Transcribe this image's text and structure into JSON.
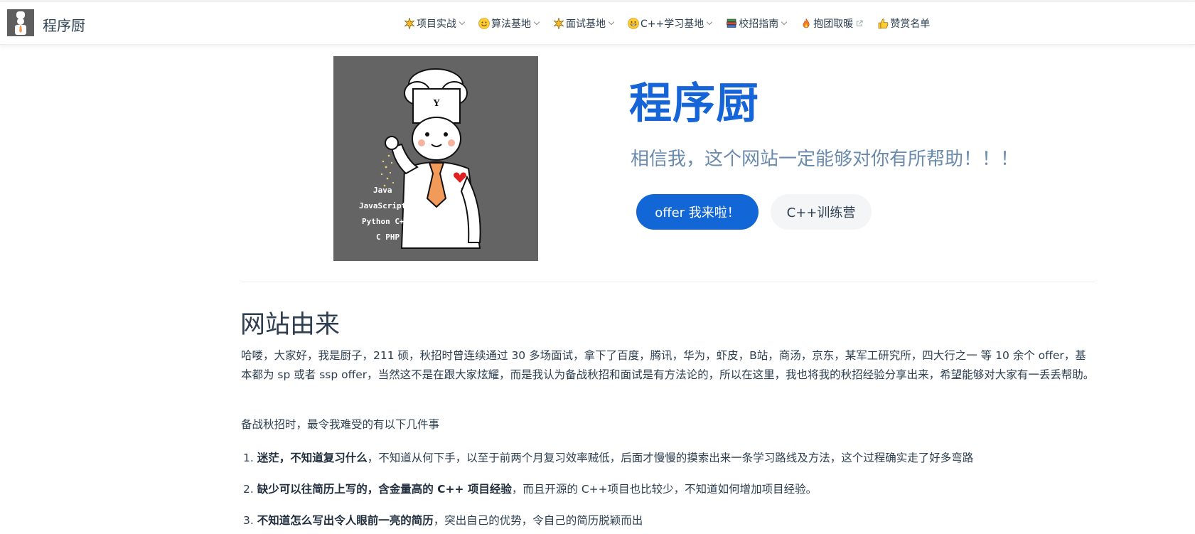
{
  "site": {
    "name": "程序厨"
  },
  "nav": {
    "items": [
      {
        "label": "项目实战",
        "icon": "sparkle-icon"
      },
      {
        "label": "算法基地",
        "icon": "smile-face-icon"
      },
      {
        "label": "面试基地",
        "icon": "sparkle-icon"
      },
      {
        "label": "C++学习基地",
        "icon": "grin-face-icon"
      },
      {
        "label": "校招指南",
        "icon": "book-stack-icon"
      },
      {
        "label": "抱团取暖",
        "icon": "fire-icon"
      },
      {
        "label": "赞赏名单",
        "icon": "thumbs-up-icon"
      }
    ]
  },
  "hero": {
    "title": "程序厨",
    "tagline": "相信我，这个网站一定能够对你有所帮助！！！",
    "primary_button": "offer 我来啦！",
    "secondary_button": "C++训练营",
    "image_text": [
      "Java",
      "JavaScript",
      "Python  C++",
      "C   PHP"
    ]
  },
  "content": {
    "section_title": "网站由来",
    "intro": "哈喽，大家好，我是厨子，211 硕，秋招时曾连续通过 30 多场面试，拿下了百度，腾讯，华为，虾皮，B站，商汤，京东，某军工研究所，四大行之一 等 10 余个 offer，基本都为 sp 或者 ssp offer，当然这不是在跟大家炫耀，而是我认为备战秋招和面试是有方法论的，所以在这里，我也将我的秋招经验分享出来，希望能够对大家有一丢丢帮助。",
    "lead": "备战秋招时，最令我难受的有以下几件事",
    "list": [
      {
        "num": "1.",
        "bold": "迷茫，不知道复习什么",
        "rest": "，不知道从何下手，以至于前两个月复习效率贼低，后面才慢慢的摸索出来一条学习路线及方法，这个过程确实走了好多弯路"
      },
      {
        "num": "2.",
        "bold": "缺少可以往简历上写的，含金量高的 C++ 项目经验",
        "rest": "，而且开源的 C++项目也比较少，不知道如何增加项目经验。"
      },
      {
        "num": "3.",
        "bold": "不知道怎么写出令人眼前一亮的简历",
        "rest": "，突出自己的优势，令自己的简历脱颖而出"
      }
    ]
  },
  "colors": {
    "accent": "#1366d6",
    "title": "#1565d8",
    "tagline": "#6a8bad",
    "text": "#2c3e50"
  }
}
